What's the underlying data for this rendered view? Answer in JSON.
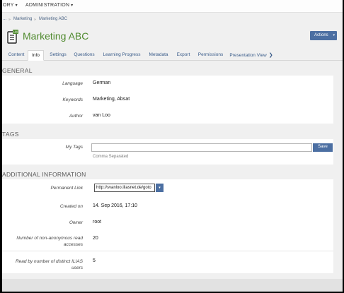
{
  "topnav": {
    "items": [
      {
        "label": "ORY",
        "caret": "▾"
      },
      {
        "label": "ADMINISTRATION",
        "caret": "▾"
      }
    ]
  },
  "breadcrumb": {
    "items": [
      "...",
      "Marketing",
      "Marketing ABC"
    ],
    "separator": "»"
  },
  "header": {
    "title": "Marketing ABC",
    "icon": "learning-module-icon",
    "actions_label": "Actions",
    "actions_caret": "▾"
  },
  "tabs": [
    {
      "label": "Content",
      "active": false
    },
    {
      "label": "Info",
      "active": true
    },
    {
      "label": "Settings",
      "active": false
    },
    {
      "label": "Questions",
      "active": false
    },
    {
      "label": "Learning Progress",
      "active": false
    },
    {
      "label": "Metadata",
      "active": false
    },
    {
      "label": "Export",
      "active": false
    },
    {
      "label": "Permissions",
      "active": false
    },
    {
      "label": "Presentation View",
      "active": false
    }
  ],
  "general": {
    "heading": "GENERAL",
    "rows": [
      {
        "label": "Language",
        "value": "German"
      },
      {
        "label": "Keywords",
        "value": "Marketing, Absat"
      },
      {
        "label": "Author",
        "value": "van Loo"
      }
    ]
  },
  "tags": {
    "heading": "TAGS",
    "label": "My Tags",
    "value": "",
    "save_label": "Save",
    "hint": "Comma Separated"
  },
  "additional": {
    "heading": "ADDITIONAL INFORMATION",
    "permalink_label": "Permanent Link",
    "permalink_value": "http://svanloo.iliasnet.de/goto",
    "rows": [
      {
        "label": "Created on",
        "value": "14. Sep 2016, 17:10"
      },
      {
        "label": "Owner",
        "value": "root"
      },
      {
        "label": "Number of non-anonymous read accesses",
        "value": "20"
      },
      {
        "label": "Read by number of distinct ILIAS users",
        "value": "5"
      }
    ]
  },
  "colors": {
    "accent": "#4c6fa2",
    "title_green": "#4f8a2e",
    "link_blue": "#3a5c8a"
  }
}
